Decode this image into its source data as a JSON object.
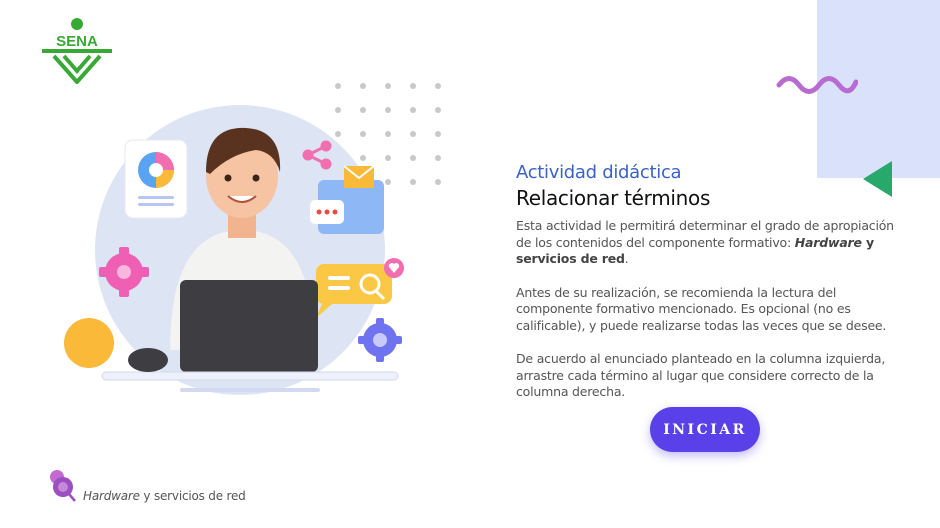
{
  "brand": {
    "logo_text": "SENA",
    "logo_color": "#39a935"
  },
  "activity": {
    "type_label": "Actividad didáctica",
    "title": "Relacionar términos",
    "intro_pre": "Esta actividad le permitirá determinar el grado de apropiación de los contenidos del componente formativo: ",
    "intro_topic_italic": "Hardware",
    "intro_topic_bold": " y servicios de red",
    "intro_end": ".",
    "paragraph_2": "Antes de su realización, se recomienda la lectura del componente formativo mencionado.  Es opcional (no es calificable), y puede realizarse todas las veces que se desee.",
    "paragraph_3": "De acuerdo al enunciado planteado en la columna izquierda, arrastre cada término al lugar que considere correcto de la columna derecha."
  },
  "start_button": {
    "label": "INICIAR",
    "color": "#5a40e8"
  },
  "footer": {
    "topic_italic": "Hardware",
    "topic_rest": " y servicios de red"
  },
  "colors": {
    "accent_blue": "#3b62c4",
    "deco_rect": "#d9e1fb",
    "wave": "#b86bd0",
    "triangle": "#27a96c",
    "yellow": "#fbb93a"
  },
  "icons": [
    "sena-logo-icon",
    "wave-decoration-icon",
    "triangle-decoration-icon",
    "dots-grid-icon",
    "student-laptop-illustration",
    "pin-icon"
  ]
}
